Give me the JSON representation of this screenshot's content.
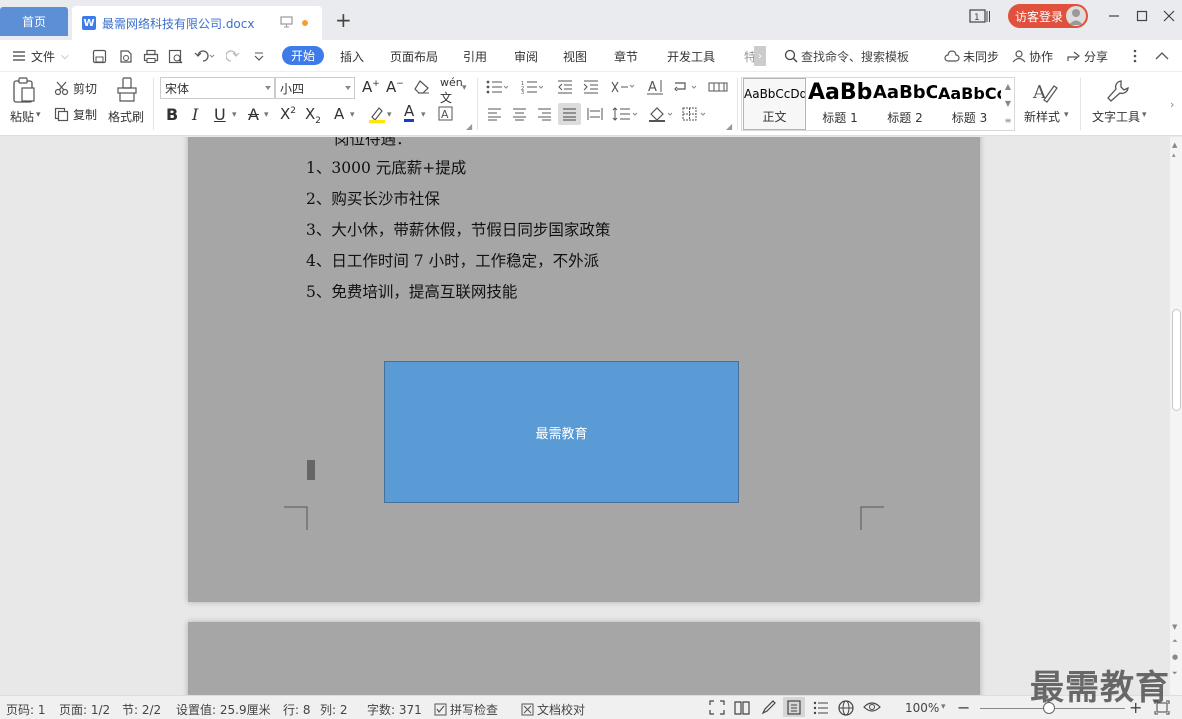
{
  "tabs": {
    "home": "首页",
    "document": "最需网络科技有限公司.docx"
  },
  "window": {
    "login": "访客登录"
  },
  "menu": {
    "file": "文件",
    "items": [
      "开始",
      "插入",
      "页面布局",
      "引用",
      "审阅",
      "视图",
      "章节",
      "开发工具",
      "特"
    ],
    "search": "查找命令、搜索模板",
    "sync": "未同步",
    "collab": "协作",
    "share": "分享"
  },
  "ribbon": {
    "paste": "粘贴",
    "cut": "剪切",
    "copy": "复制",
    "format_painter": "格式刷",
    "font_name": "宋体",
    "font_size": "小四",
    "styles": [
      {
        "sample": "AaBbCcDd",
        "name": "正文"
      },
      {
        "sample": "AaBb",
        "name": "标题 1"
      },
      {
        "sample": "AaBbC",
        "name": "标题 2"
      },
      {
        "sample": "AaBbCc",
        "name": "标题 3"
      }
    ],
    "new_style": "新样式",
    "text_tools": "文字工具"
  },
  "document": {
    "heading_partial": "岗位待遇：",
    "lines": [
      "1、3000 元底薪+提成",
      "2、购买长沙市社保",
      "3、大小休，带薪休假，节假日同步国家政策",
      "4、日工作时间 7 小时，工作稳定，不外派",
      "5、免费培训，提高互联网技能"
    ],
    "textbox": "最需教育"
  },
  "status": {
    "page_num": "页码: 1",
    "pages": "页面: 1/2",
    "section": "节: 2/2",
    "setting": "设置值: 25.9厘米",
    "row": "行: 8",
    "col": "列: 2",
    "word_count": "字数: 371",
    "spell_check": "拼写检查",
    "doc_proof": "文档校对",
    "zoom": "100%"
  },
  "watermark": "最需教育",
  "colors": {
    "accent": "#3d7ce8",
    "login": "#e0503c",
    "textbox_fill": "#5b9bd5",
    "page_bg": "#a6a6a6"
  }
}
